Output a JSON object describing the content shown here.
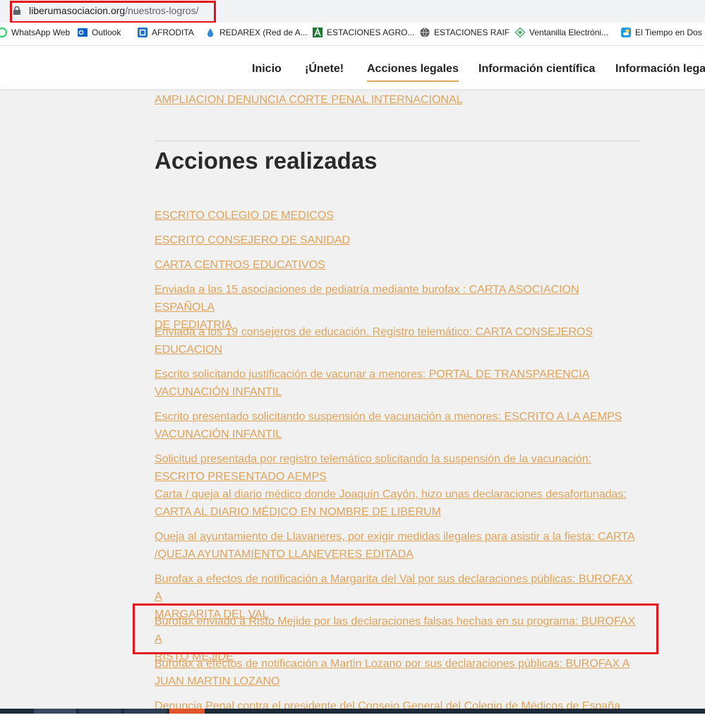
{
  "browser": {
    "url_domain": "liberumasociacion.org",
    "url_path": "/nuestros-logros/"
  },
  "bookmarks": [
    {
      "label": "WhatsApp Web",
      "icon": "whatsapp-icon",
      "color": "#25d366"
    },
    {
      "label": "Outlook",
      "icon": "outlook-icon",
      "color": "#0a64c8"
    },
    {
      "label": "AFRODITA",
      "icon": "afrodita-icon",
      "color": "#1c6fc7"
    },
    {
      "label": "REDAREX (Red de A...",
      "icon": "drop-icon",
      "color": "#2a8ad4"
    },
    {
      "label": "ESTACIONES AGRO...",
      "icon": "agro-icon",
      "color": "#1e7a32"
    },
    {
      "label": "ESTACIONES RAIF",
      "icon": "globe-icon",
      "color": "#555555"
    },
    {
      "label": "Ventanilla Electróni...",
      "icon": "ventanilla-icon",
      "color": "#4aa86a"
    },
    {
      "label": "El Tiempo en Dos",
      "icon": "weather-icon",
      "color": "#1e9be6"
    }
  ],
  "nav": [
    "Inicio",
    "¡Únete!",
    "Acciones legales",
    "Información científica",
    "Información legal"
  ],
  "prev_link": "AMPLIACION DENUNCIA CORTE PENAL INTERNACIONAL",
  "section_title": "Acciones realizadas",
  "actions": [
    "ESCRITO COLEGIO DE MEDICOS",
    "ESCRITO CONSEJERO DE SANIDAD",
    "CARTA CENTROS EDUCATIVOS",
    [
      "Enviada a las 15 asociaciones de pediatría mediante burofax : CARTA ASOCIACION ESPAÑOLA",
      "DE PEDIATRIA"
    ],
    [
      "Enviada a los 19 consejeros de educación. Registro telemático: CARTA CONSEJEROS",
      "EDUCACION"
    ],
    [
      "Escrito solicitando justificación de vacunar a menores: PORTAL DE TRANSPARENCIA",
      "VACUNACIÓN INFANTIL"
    ],
    [
      "Escrito presentado solicitando suspensión de vacunación a menores: ESCRITO A LA AEMPS",
      "VACUNACIÓN INFANTIL"
    ],
    [
      "Solicitud presentada por registro telemático solicitando la suspensión de la vacunación:",
      "ESCRITO PRESENTADO AEMPS"
    ],
    [
      "Carta / queja al diario médico donde Joaquín Cayón, hizo unas declaraciones desafortunadas:",
      "CARTA AL DIARIO MÉDICO EN NOMBRE DE LIBERUM"
    ],
    [
      "Queja al ayuntamiento de Llavaneres, por exigir medidas ilegales para asistir a la fiesta: CARTA",
      "/QUEJA AYUNTAMIENTO LLANEVERES EDITADA"
    ],
    [
      "Burofax a efectos de notificación a Margarita del Val por sus declaraciones públicas: BUROFAX A",
      "MARGARITA DEL VAL"
    ],
    [
      "Burofax enviado a Risto Mejide por las declaraciones falsas hechas en su programa: BUROFAX A",
      "RISTO MEJIDE"
    ],
    [
      "Burofax a efectos de notificación a Martin Lozano por sus declaraciones públicas: BUROFAX A",
      "JUAN MARTIN LOZANO"
    ],
    "Denuncia Penal contra el presidente del Consejo General del Colegio de Médicos de España"
  ],
  "colors": {
    "link": "#e0a35a",
    "highlight": "#e3141b",
    "nav_underline": "#e1a75a"
  }
}
